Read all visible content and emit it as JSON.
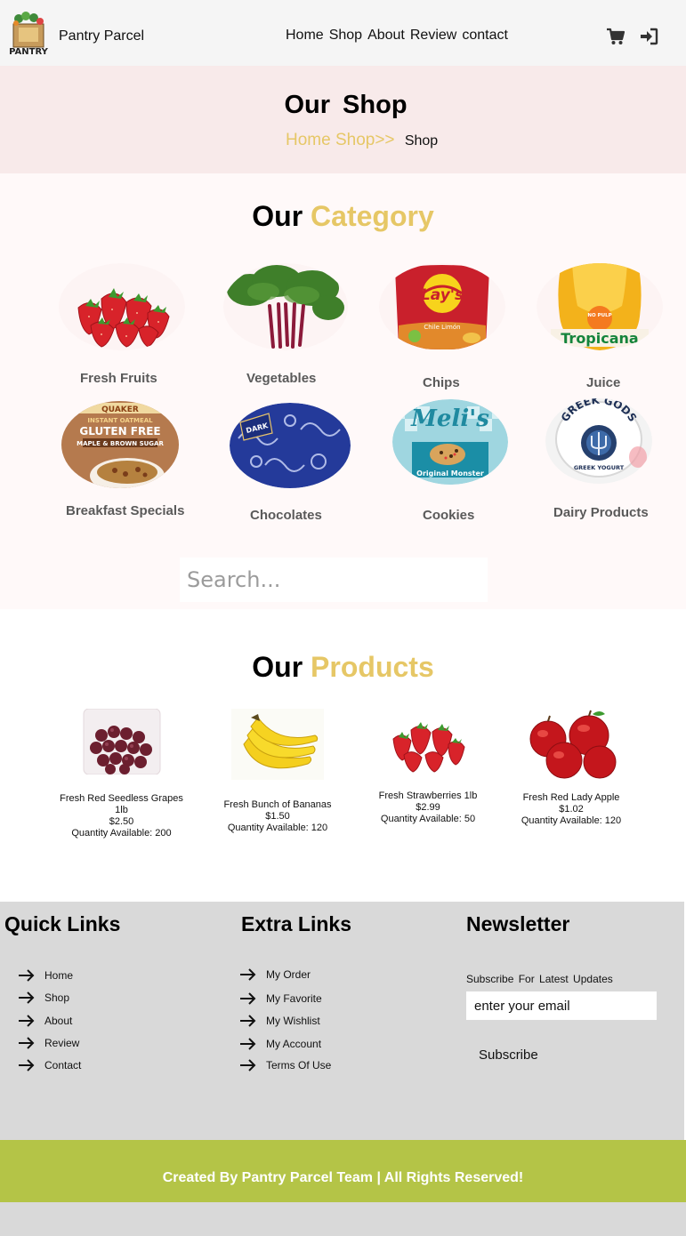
{
  "nav": {
    "brand": "Pantry Parcel",
    "logo_text": "PANTRY",
    "menu": [
      "Home",
      "Shop",
      "About",
      "Review",
      "contact"
    ],
    "icons": [
      "cart-icon",
      "sign-in-icon"
    ]
  },
  "hero": {
    "title": "Our  Shop",
    "crumb_link": "Home Shop>>",
    "crumb_current": "Shop"
  },
  "category": {
    "title_prefix": "Our",
    "title_accent": "Category",
    "items": [
      {
        "label": "Fresh Fruits"
      },
      {
        "label": "Vegetables"
      },
      {
        "label": "Chips"
      },
      {
        "label": "Juice"
      },
      {
        "label": "Breakfast Specials"
      },
      {
        "label": "Chocolates"
      },
      {
        "label": "Cookies"
      },
      {
        "label": "Dairy Products"
      }
    ],
    "image_text": {
      "lays": "Lay's",
      "lays_sub": "Chile Limón",
      "tropicana": "Tropicana",
      "tropicana_badge": "NO PULP",
      "oats_brand": "QUAKER",
      "oats_line": "INSTANT OATMEAL",
      "oats_title": "GLUTEN FREE",
      "oats_flavor": "MAPLE & BROWN SUGAR",
      "choc_label": "DARK",
      "cookies_brand": "Meli's",
      "cookies_flavor": "Original Monster",
      "yogurt_brand": "GREEK GODS",
      "yogurt_sub": "GREEK YOGURT"
    }
  },
  "search": {
    "placeholder": "Search..."
  },
  "products": {
    "title_prefix": "Our",
    "title_accent": "Products",
    "items": [
      {
        "name": "Fresh Red Seedless Grapes 1lb",
        "price": "$2.50",
        "qty": "Quantity Available: 200"
      },
      {
        "name": "Fresh Bunch of Bananas",
        "price": "$1.50",
        "qty": "Quantity Available: 120"
      },
      {
        "name": "Fresh Strawberries 1lb",
        "price": "$2.99",
        "qty": "Quantity Available: 50"
      },
      {
        "name": "Fresh Red Lady Apple",
        "price": "$1.02",
        "qty": "Quantity Available: 120"
      }
    ]
  },
  "footer": {
    "quick_title": "Quick Links",
    "quick_links": [
      "Home",
      "Shop",
      "About",
      "Review",
      "Contact"
    ],
    "extra_title": "Extra Links",
    "extra_links": [
      "My Order",
      "My Favorite",
      "My Wishlist",
      "My Account",
      "Terms  Of Use"
    ],
    "newsletter_title": "Newsletter",
    "newsletter_sub": "Subscribe  For Latest Updates",
    "email_placeholder": "enter your email",
    "subscribe_label": "Subscribe",
    "credits": "Created By Pantry Parcel Team | All Rights Reserved!"
  },
  "colors": {
    "accent_gold": "#e6c766",
    "hero_bg": "#f8eaea",
    "footer_bg": "#d9d9d9",
    "credits_bg": "#b4c447"
  }
}
